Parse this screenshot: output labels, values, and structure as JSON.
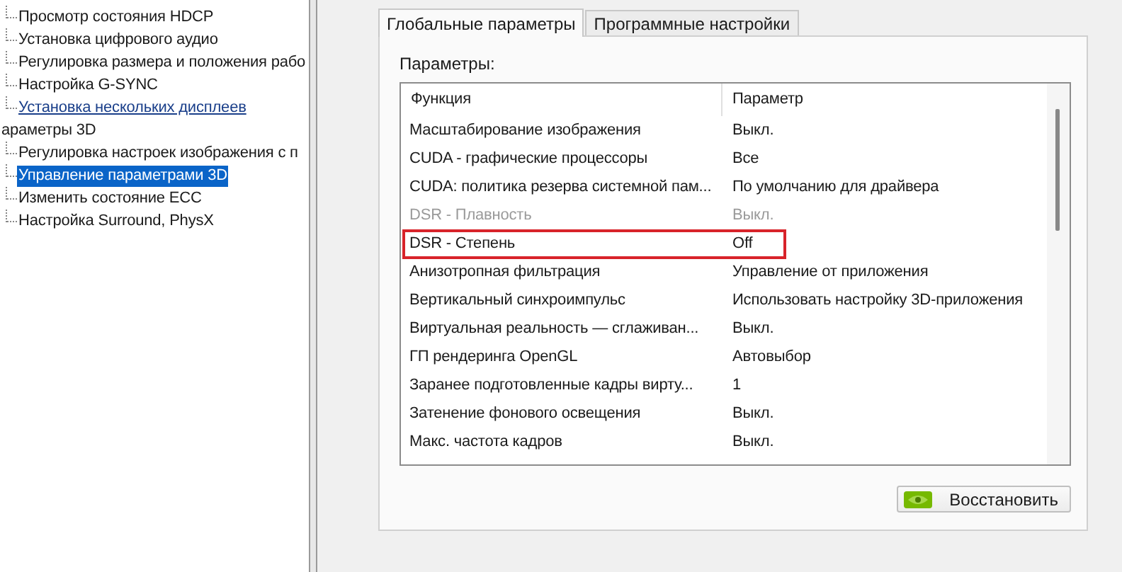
{
  "tree": [
    {
      "children": [
        {
          "label": "Просмотр состояния HDCP",
          "selected": false,
          "hovered": false
        },
        {
          "label": "Установка цифрового аудио",
          "selected": false,
          "hovered": false
        },
        {
          "label": "Регулировка размера и положения рабо",
          "selected": false,
          "hovered": false
        },
        {
          "label": "Настройка G-SYNC",
          "selected": false,
          "hovered": false
        },
        {
          "label": "Установка нескольких дисплеев",
          "selected": false,
          "hovered": true
        }
      ]
    },
    {
      "label": "араметры 3D",
      "children": [
        {
          "label": "Регулировка настроек изображения с п",
          "selected": false,
          "hovered": false
        },
        {
          "label": "Управление параметрами 3D",
          "selected": true,
          "hovered": false
        },
        {
          "label": "Изменить состояние ECC",
          "selected": false,
          "hovered": false
        },
        {
          "label": "Настройка Surround, PhysX",
          "selected": false,
          "hovered": false
        }
      ]
    }
  ],
  "tabs": [
    {
      "label": "Глобальные параметры",
      "selected": true
    },
    {
      "label": "Программные настройки",
      "selected": false
    }
  ],
  "settings_label": "Параметры:",
  "table": {
    "columns": [
      "Функция",
      "Параметр"
    ],
    "rows": [
      {
        "function": "Масштабирование изображения",
        "value": "Выкл.",
        "disabled": false,
        "highlighted": false
      },
      {
        "function": "CUDA - графические процессоры",
        "value": "Все",
        "disabled": false,
        "highlighted": false
      },
      {
        "function": "CUDA: политика резерва системной пам...",
        "value": "По умолчанию для драйвера",
        "disabled": false,
        "highlighted": false
      },
      {
        "function": "DSR - Плавность",
        "value": "Выкл.",
        "disabled": true,
        "highlighted": false
      },
      {
        "function": "DSR - Степень",
        "value": "Off",
        "disabled": false,
        "highlighted": true
      },
      {
        "function": "Анизотропная фильтрация",
        "value": "Управление от приложения",
        "disabled": false,
        "highlighted": false
      },
      {
        "function": "Вертикальный синхроимпульс",
        "value": "Использовать настройку 3D-приложения",
        "disabled": false,
        "highlighted": false
      },
      {
        "function": "Виртуальная реальность — сглаживан...",
        "value": "Выкл.",
        "disabled": false,
        "highlighted": false
      },
      {
        "function": "ГП рендеринга OpenGL",
        "value": "Автовыбор",
        "disabled": false,
        "highlighted": false
      },
      {
        "function": "Заранее подготовленные кадры вирту...",
        "value": "1",
        "disabled": false,
        "highlighted": false
      },
      {
        "function": "Затенение фонового освещения",
        "value": "Выкл.",
        "disabled": false,
        "highlighted": false
      },
      {
        "function": "Макс. частота кадров",
        "value": "Выкл.",
        "disabled": false,
        "highlighted": false
      }
    ]
  },
  "restore_button": "Восстановить"
}
